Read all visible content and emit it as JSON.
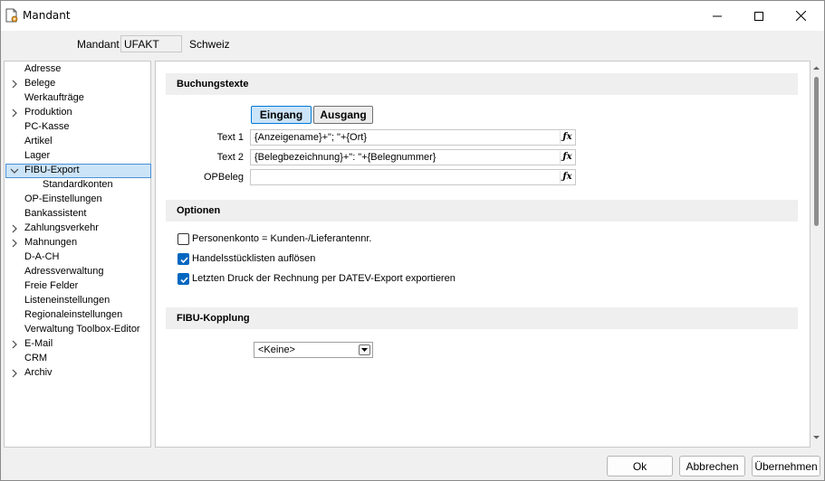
{
  "window": {
    "title": "Mandant"
  },
  "mandant": {
    "label": "Mandant",
    "code": "UFAKT",
    "name": "Schweiz"
  },
  "tree": {
    "items": [
      {
        "label": "Adresse",
        "expandable": false
      },
      {
        "label": "Belege",
        "expandable": true
      },
      {
        "label": "Werkaufträge",
        "expandable": false
      },
      {
        "label": "Produktion",
        "expandable": true
      },
      {
        "label": "PC-Kasse",
        "expandable": false
      },
      {
        "label": "Artikel",
        "expandable": false
      },
      {
        "label": "Lager",
        "expandable": false
      },
      {
        "label": "FIBU-Export",
        "expandable": true,
        "expanded": true,
        "selected": true
      },
      {
        "label": "Standardkonten",
        "child": true
      },
      {
        "label": "OP-Einstellungen",
        "expandable": false
      },
      {
        "label": "Bankassistent",
        "expandable": false
      },
      {
        "label": "Zahlungsverkehr",
        "expandable": true
      },
      {
        "label": "Mahnungen",
        "expandable": true
      },
      {
        "label": "D-A-CH",
        "expandable": false
      },
      {
        "label": "Adressverwaltung",
        "expandable": false
      },
      {
        "label": "Freie Felder",
        "expandable": false
      },
      {
        "label": "Listeneinstellungen",
        "expandable": false
      },
      {
        "label": "Regionaleinstellungen",
        "expandable": false
      },
      {
        "label": "Verwaltung Toolbox-Editor",
        "expandable": false
      },
      {
        "label": "E-Mail",
        "expandable": true
      },
      {
        "label": "CRM",
        "expandable": false
      },
      {
        "label": "Archiv",
        "expandable": true
      }
    ]
  },
  "buchungstexte": {
    "heading": "Buchungstexte",
    "tab_in": "Eingang",
    "tab_out": "Ausgang",
    "text1_label": "Text 1",
    "text1_value": "{Anzeigename}+\"; \"+{Ort}",
    "text2_label": "Text 2",
    "text2_value": "{Belegbezeichnung}+\": \"+{Belegnummer}",
    "opbeleg_label": "OPBeleg",
    "opbeleg_value": "",
    "fx": "fx"
  },
  "optionen": {
    "heading": "Optionen",
    "opt1": "Personenkonto = Kunden-/Lieferantennr.",
    "opt1_checked": false,
    "opt2": "Handelsstücklisten auflösen",
    "opt2_checked": true,
    "opt3": "Letzten Druck der Rechnung per DATEV-Export exportieren",
    "opt3_checked": true
  },
  "kopplung": {
    "heading": "FIBU-Kopplung",
    "selected": "<Keine>"
  },
  "buttons": {
    "ok": "Ok",
    "cancel": "Abbrechen",
    "apply": "Übernehmen"
  }
}
